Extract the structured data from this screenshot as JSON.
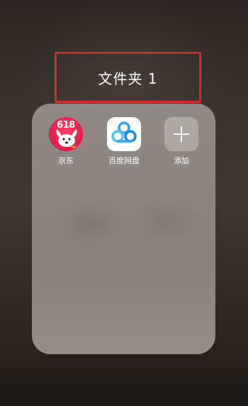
{
  "folder": {
    "title": "文件夹 1"
  },
  "apps": [
    {
      "label": "京东",
      "icon": "jd-icon",
      "badge": "618"
    },
    {
      "label": "百度网盘",
      "icon": "baidu-netdisk-icon"
    },
    {
      "label": "添加",
      "icon": "plus-icon"
    }
  ],
  "colors": {
    "highlight_border": "#d42d2d",
    "jd_red": "#e21b4a",
    "baidu_blue": "#2fa6f4"
  }
}
